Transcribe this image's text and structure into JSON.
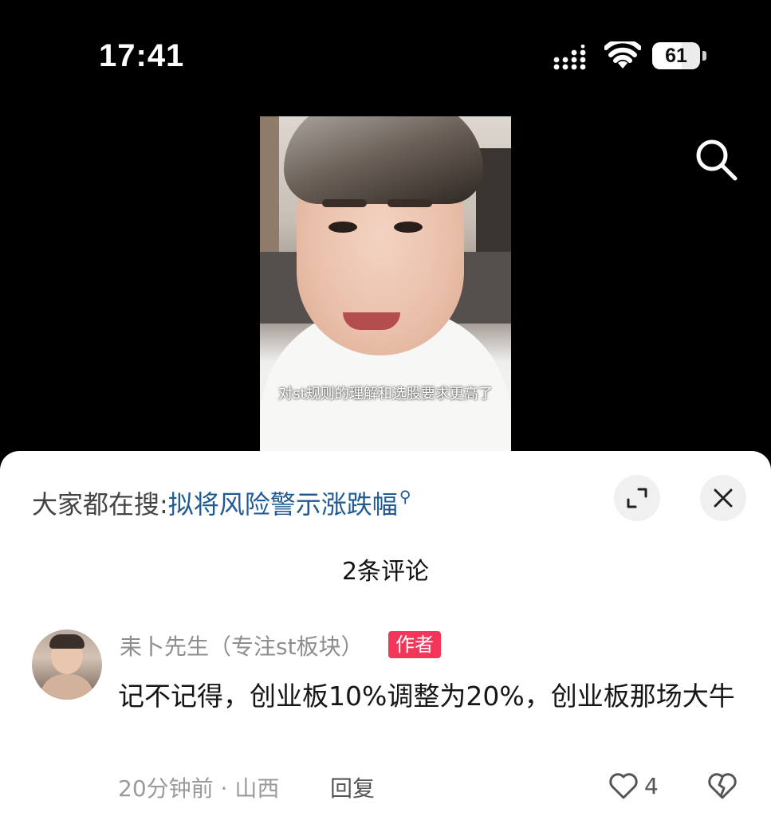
{
  "status_bar": {
    "time": "17:41",
    "battery": "61",
    "battery_level": 0.61
  },
  "video": {
    "caption": "对st规则的理解和选股要求更高了"
  },
  "sheet": {
    "search_prefix": "大家都在搜:",
    "search_term": "拟将风险警示涨跌幅",
    "comment_count_label": "2条评论"
  },
  "comments": [
    {
      "username": "耒卜先生（专注st板块）",
      "badge": "作者",
      "text": "记不记得，创业板10%调整为20%，创业板那场大牛",
      "time_location": "20分钟前 · 山西",
      "reply_label": "回复",
      "likes": "4"
    }
  ],
  "icons": {
    "search": "search-icon",
    "expand": "expand-icon",
    "close": "close-icon",
    "like": "heart-icon",
    "dislike": "broken-heart-icon"
  },
  "colors": {
    "search_term": "#1f5a93",
    "badge": "#f2365a",
    "background": "#000000",
    "sheet": "#ffffff"
  }
}
